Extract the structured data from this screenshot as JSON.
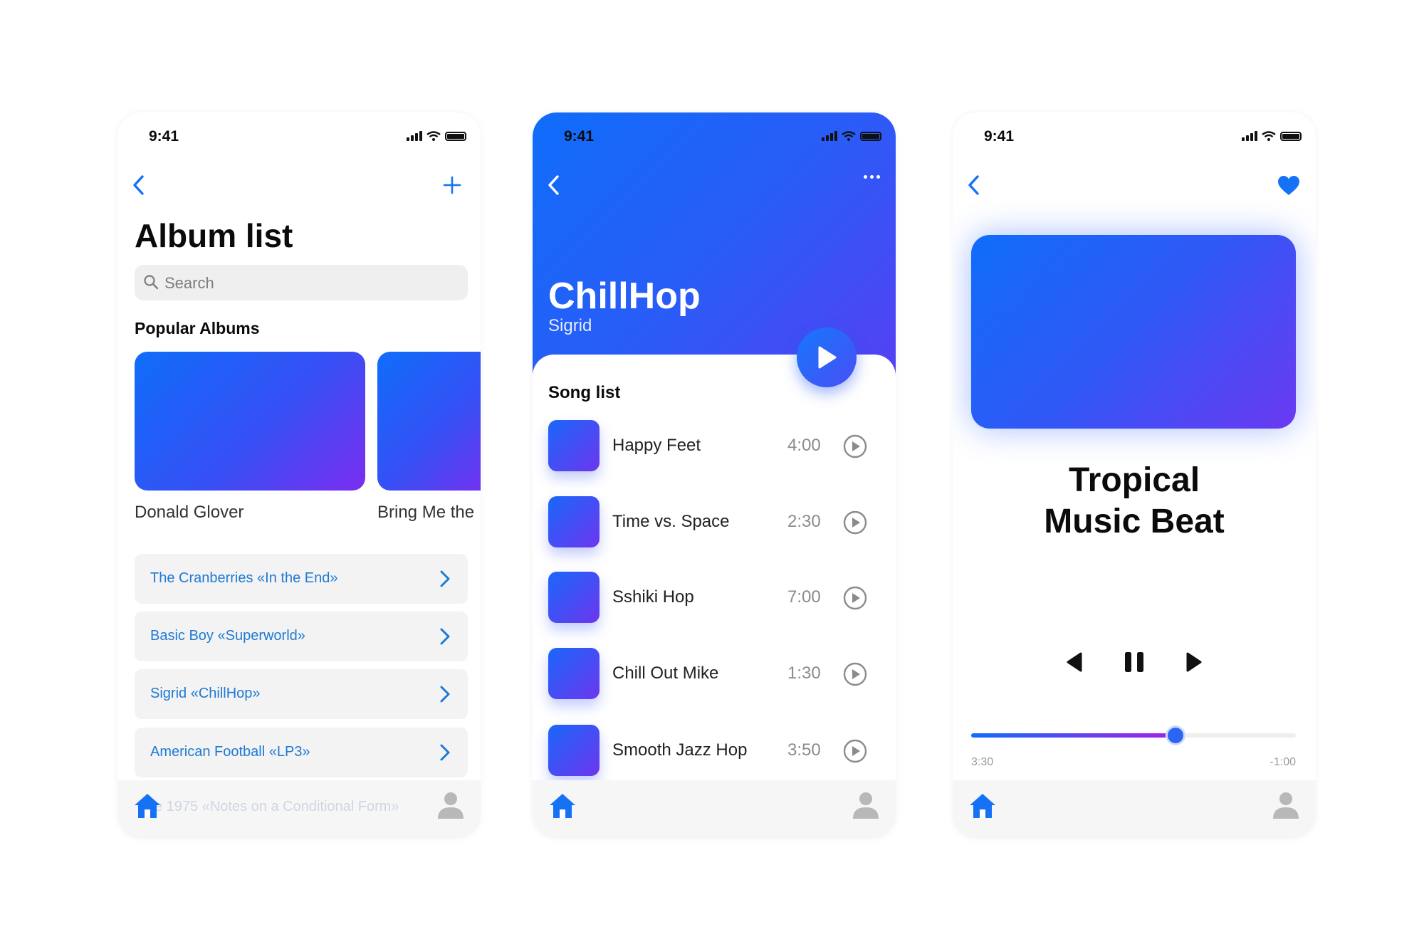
{
  "status_bar": {
    "time": "9:41"
  },
  "album_list_screen": {
    "title": "Album list",
    "search_placeholder": "Search",
    "section_title": "Popular Albums",
    "popular_albums": [
      {
        "label": "Donald Glover"
      },
      {
        "label": "Bring Me the"
      }
    ],
    "albums": [
      "The Cranberries «In the End»",
      "Basic Boy «Superworld»",
      "Sigrid «ChillHop»",
      "American Football «LP3»"
    ],
    "obscured_item": "e 1975 «Notes on a Conditional Form»"
  },
  "album_screen": {
    "title": "ChillHop",
    "artist": "Sigrid",
    "section_title": "Song list",
    "songs": [
      {
        "name": "Happy Feet",
        "duration": "4:00"
      },
      {
        "name": "Time vs. Space",
        "duration": "2:30"
      },
      {
        "name": "Sshiki Hop",
        "duration": "7:00"
      },
      {
        "name": "Chill Out Mike",
        "duration": "1:30"
      },
      {
        "name": "Smooth Jazz Hop",
        "duration": "3:50"
      }
    ]
  },
  "player_screen": {
    "title": "Tropical Music Beat",
    "elapsed": "3:30",
    "remaining": "-1:00",
    "progress": 0.63,
    "favorited": true
  },
  "colors": {
    "accent": "#0f6dfa",
    "accent_purple": "#7b2df0",
    "link_text": "#1e7ad3",
    "tab_home": "#1672f4",
    "tab_user": "#b8b8b8"
  },
  "icons": [
    "back-icon",
    "plus-icon",
    "search-icon",
    "chevron-right-icon",
    "more-icon",
    "play-icon",
    "heart-icon",
    "previous-icon",
    "pause-icon",
    "next-icon",
    "home-icon",
    "user-icon",
    "signal-icon",
    "wifi-icon",
    "battery-icon"
  ]
}
